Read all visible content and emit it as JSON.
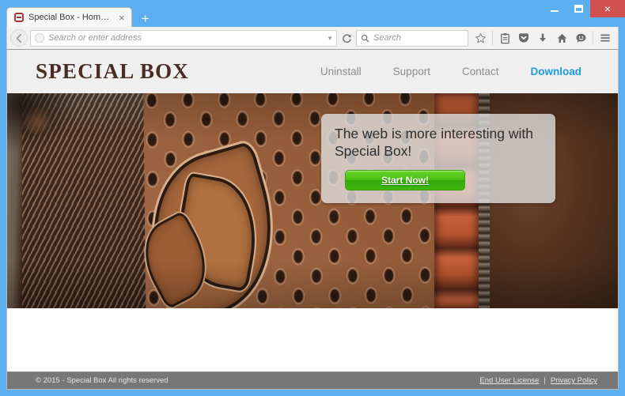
{
  "browser": {
    "window_controls": {
      "minimize_label": "Minimize",
      "maximize_label": "Restore",
      "close_label": "×"
    },
    "tab": {
      "title": "Special Box - Home Page",
      "close_label": "×",
      "favicon": "box-favicon"
    },
    "new_tab_label": "+",
    "back_label": "Back",
    "reload_label": "⟳",
    "address_bar": {
      "value": "",
      "placeholder": "Search or enter address",
      "dropdown_label": "▼"
    },
    "search_bar": {
      "value": "",
      "placeholder": "Search"
    },
    "toolbar_icons": [
      "bookmark-star-icon",
      "reading-list-icon",
      "pocket-icon",
      "downloads-icon",
      "home-icon",
      "feedback-smiley-icon",
      "hamburger-menu-icon"
    ]
  },
  "site": {
    "brand": "SPECIAL BOX",
    "nav": [
      {
        "label": "Uninstall",
        "accent": false
      },
      {
        "label": "Support",
        "accent": false
      },
      {
        "label": "Contact",
        "accent": false
      },
      {
        "label": "Download",
        "accent": true
      }
    ],
    "promo": {
      "headline": "The web is more interesting with Special Box!",
      "button_label": "Start Now!"
    },
    "footer": {
      "copyright": "© 2015 - Special Box All rights reserved",
      "separator": "|",
      "links": [
        {
          "label": "End User License"
        },
        {
          "label": "Privacy Policy"
        }
      ]
    }
  },
  "colors": {
    "window_frame": "#5CAFEF",
    "close_button": "#D0504F",
    "brand_text": "#4A2C24",
    "nav_link": "#8C8C8C",
    "nav_accent": "#1F9BDE",
    "promo_button_green": "#46BE10",
    "footer_bg": "#777777",
    "header_bg": "#EFEFEF"
  }
}
